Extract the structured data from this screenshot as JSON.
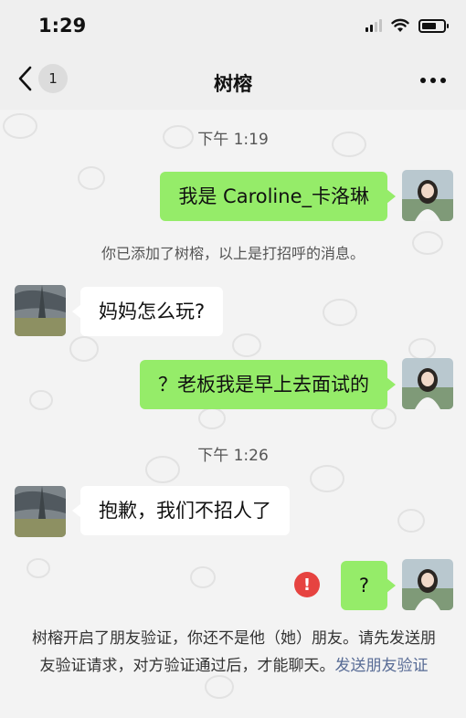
{
  "status_bar": {
    "time": "1:29",
    "battery_level": 0.7
  },
  "nav": {
    "back_badge": "1",
    "title": "树榕"
  },
  "icons": {
    "back": "chevron-left-icon",
    "more": "more-dots-icon",
    "error": "exclamation-icon"
  },
  "colors": {
    "outgoing_bubble": "#95ec69",
    "incoming_bubble": "#ffffff",
    "error": "#e64340",
    "link": "#576b95"
  },
  "chat": {
    "time_1": "下午 1:19",
    "msg_1": "我是 Caroline_卡洛琳",
    "system_1": "你已添加了树榕，以上是打招呼的消息。",
    "msg_2": "妈妈怎么玩?",
    "msg_3": "？老板我是早上去面试的",
    "time_2": "下午 1:26",
    "msg_4": "抱歉，我们不招人了",
    "msg_5": "?",
    "error_mark": "!"
  },
  "footer": {
    "text": "树榕开启了朋友验证，你还不是他（她）朋友。请先发送朋友验证请求，对方验证通过后，才能聊天。",
    "link": "发送朋友验证"
  }
}
